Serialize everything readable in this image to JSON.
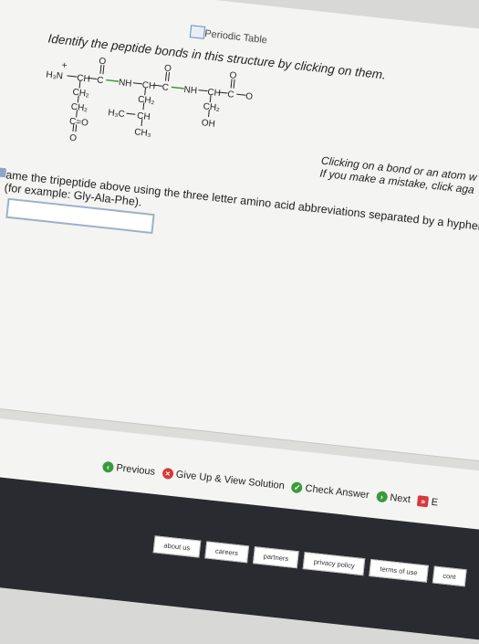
{
  "tab": {
    "title": "Periodic Table",
    "icon": "periodic-table-icon"
  },
  "question": "Identify the peptide bonds in this structure by clicking on them.",
  "structure": {
    "labels": {
      "h3n": "H₃N",
      "plus": "+",
      "ch1": "CH",
      "ch2a": "CH₂",
      "ch2b": "CH₂",
      "co1": "C=O",
      "ominus1": "O",
      "o1": "O",
      "c1": "C",
      "nh1": "NH",
      "ch3": "CH",
      "ch2c": "CH₂",
      "h3c": "H₃C",
      "ch4": "CH",
      "ch3b": "CH₃",
      "o2": "O",
      "c2": "C",
      "nh2": "NH",
      "ch5": "CH",
      "ch2d": "CH₂",
      "oh": "OH",
      "o3": "O",
      "c3": "C",
      "ominus2": "O"
    }
  },
  "hint": {
    "line1": "Clicking on a bond or an atom w",
    "line2": "If you make a mistake, click aga"
  },
  "name_prompt": "ame the tripeptide above using the three letter amino acid abbreviations separated by a hyphen",
  "name_example": "(for example: Gly-Ala-Phe).",
  "answer_input": {
    "value": "",
    "placeholder": ""
  },
  "actions": {
    "previous": "Previous",
    "give_up": "Give Up & View Solution",
    "check": "Check Answer",
    "next": "Next",
    "end_label": "E"
  },
  "footer": [
    "about us",
    "careers",
    "partners",
    "privacy policy",
    "terms of use",
    "cont"
  ],
  "colors": {
    "green": "#3a9a3a",
    "red": "#d63a3a",
    "dark": "#2a2b30"
  }
}
